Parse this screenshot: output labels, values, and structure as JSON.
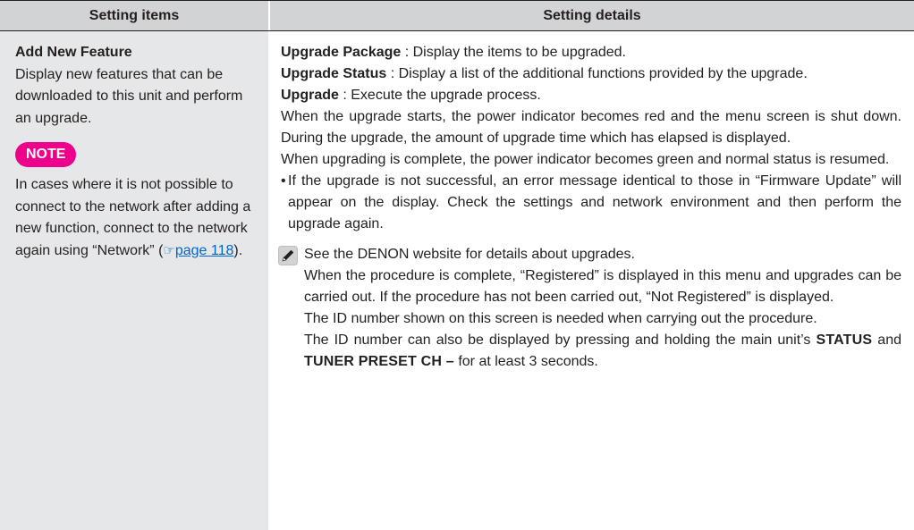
{
  "header": {
    "col_left": "Setting items",
    "col_right": "Setting details"
  },
  "item": {
    "title": "Add New Feature",
    "description": "Display new features that can be downloaded to this unit and perform an upgrade.",
    "note_label": "NOTE",
    "note_text_before": "In cases where it is not possible to connect to the network after adding a new function, connect to the network again using “Network” (",
    "note_link_icon": "pointing-hand-icon",
    "note_link": "page 118",
    "note_text_after": ")."
  },
  "details": {
    "line1_term": "Upgrade Package",
    "line1_text": " : Display the items to be upgraded.",
    "line2_term": "Upgrade Status",
    "line2_text": " : Display a list of the additional functions provided by the upgrade.",
    "line3_term": "Upgrade",
    "line3_text": " : Execute the upgrade process.",
    "para1": "When the upgrade starts, the power indicator becomes red and the menu screen is shut down. During the upgrade, the amount of upgrade time which has elapsed is displayed.",
    "para2": "When upgrading is complete, the power indicator becomes green and normal status is resumed.",
    "bullet_mark": "•",
    "bullet1": "If the upgrade is not successful, an error message identical to those in “Firmware Update” will appear on the display. Check the settings and network environment and then perform the upgrade again.",
    "memo_icon": "pencil-icon",
    "memo_line1": "See the DENON website for details about upgrades.",
    "memo_line2": "When the procedure is complete, “Registered” is displayed in this menu and upgrades can be carried out. If the procedure has not been carried out, “Not Registered” is displayed.",
    "memo_line3": "The ID number shown on this screen is needed when carrying out the procedure.",
    "memo_line4_before": "The ID number can also be displayed by pressing and holding the main unit’s ",
    "memo_line4_btn1": "STATUS",
    "memo_line4_mid": " and ",
    "memo_line4_btn2": "TUNER PRESET CH –",
    "memo_line4_after": " for at least 3 seconds."
  },
  "colors": {
    "header_bg": "#d1d3d4",
    "left_bg": "#e6e7e8",
    "note_badge": "#ec008c",
    "link": "#0066cc"
  }
}
